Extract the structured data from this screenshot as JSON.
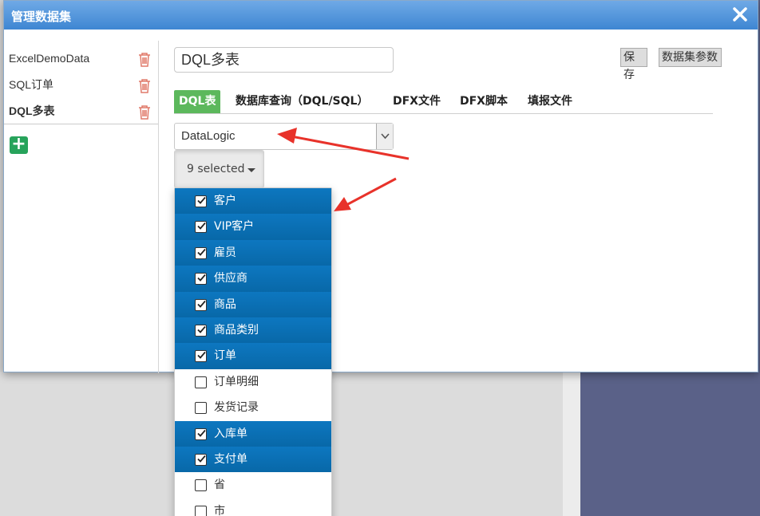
{
  "window": {
    "title": "管理数据集"
  },
  "datasets": [
    {
      "label": "ExcelDemoData",
      "active": false
    },
    {
      "label": "SQL订单",
      "active": false
    },
    {
      "label": "DQL多表",
      "active": true
    }
  ],
  "editor": {
    "name_value": "DQL多表",
    "save_label": "保存",
    "params_label": "数据集参数"
  },
  "tabs": [
    {
      "label": "DQL表",
      "active": true
    },
    {
      "label": "数据库查询（DQL/SQL）",
      "active": false
    },
    {
      "label": "DFX文件",
      "active": false
    },
    {
      "label": "DFX脚本",
      "active": false
    },
    {
      "label": "填报文件",
      "active": false
    }
  ],
  "source": {
    "selected": "DataLogic"
  },
  "multiselect": {
    "button_label": "9 selected",
    "options": [
      {
        "label": "客户",
        "checked": true
      },
      {
        "label": "VIP客户",
        "checked": true
      },
      {
        "label": "雇员",
        "checked": true
      },
      {
        "label": "供应商",
        "checked": true
      },
      {
        "label": "商品",
        "checked": true
      },
      {
        "label": "商品类别",
        "checked": true
      },
      {
        "label": "订单",
        "checked": true
      },
      {
        "label": "订单明细",
        "checked": false
      },
      {
        "label": "发货记录",
        "checked": false
      },
      {
        "label": "入库单",
        "checked": true
      },
      {
        "label": "支付单",
        "checked": true
      },
      {
        "label": "省",
        "checked": false
      },
      {
        "label": "市",
        "checked": false
      }
    ]
  },
  "colors": {
    "accent": "#0d77c0",
    "tab_active": "#5cb85c",
    "add_button": "#27a35b",
    "trash": "#e07a6a",
    "annotation_arrow": "#e8322a"
  }
}
